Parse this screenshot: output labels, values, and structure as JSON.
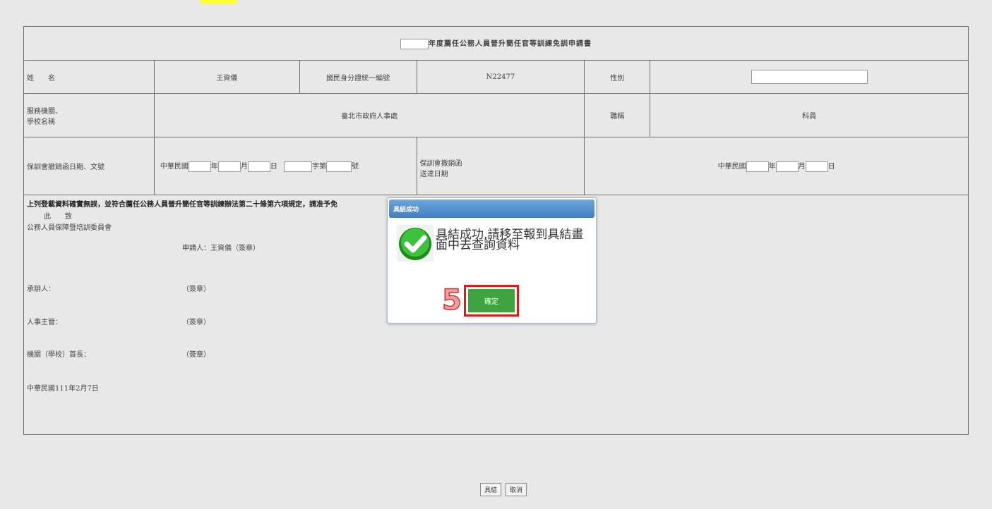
{
  "form": {
    "title": "年度薦任公務人員晉升簡任官等訓練免訓申請書",
    "name_label": "姓　　名",
    "name_value": "王資儀",
    "id_label": "國民身分證統一編號",
    "id_value": "N22477",
    "gender_label": "性別",
    "gender_value": "",
    "org_label_line1": "服務機關、",
    "org_label_line2": "學校名稱",
    "org_value": "臺北市政府人事處",
    "position_label": "職稱",
    "position_value": "科員",
    "letter_date_label": "保訓會撤銷函日期、文號",
    "roc_prefix": "中華民國",
    "year_unit": "年",
    "month_unit": "月",
    "day_unit": "日",
    "word_unit": "字第",
    "number_unit": "號",
    "delivery_label_line1": "保訓會撤銷函",
    "delivery_label_line2": "送達日期",
    "declaration": "上列登載資料確實無誤，並符合薦任公務人員晉升簡任官等訓練辦法第二十條第六項規定，請准予免",
    "salutation": "此　　致",
    "recipient": "公務人員保障暨培訓委員會",
    "applicant": "申請人：王資儀（簽章）",
    "handler_label": "承辦人：",
    "hr_head_label": "人事主管：",
    "agency_head_label": "機關（學校）首長：",
    "stamp_text": "（簽章）",
    "date_line": "中華民國111年2月7日"
  },
  "buttons": {
    "submit": "具結",
    "cancel": "取消"
  },
  "dialog": {
    "title": "具結成功",
    "message": "具結成功,請移至報到具結畫面中去查詢資料",
    "ok_label": "確定",
    "step_number": "5",
    "icon": "check-circle-icon"
  },
  "colors": {
    "dialog_header": "#4a8ac8",
    "ok_button": "#3fa33f",
    "highlight_border": "#e01818",
    "top_highlight": "#ffff33"
  }
}
